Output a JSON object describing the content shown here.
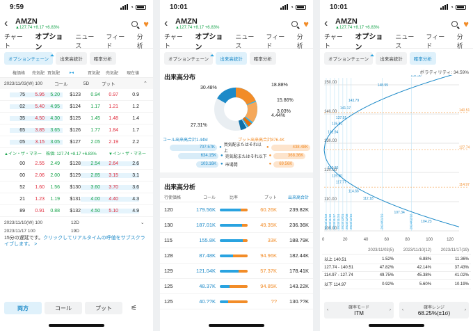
{
  "status": {
    "time1": "9:59",
    "time2": "10:01",
    "time3": "10:01"
  },
  "ticker": {
    "symbol": "AMZN",
    "change": "▲127.74 +8.17 +6.83%"
  },
  "tabs": [
    "チャート",
    "オプション",
    "ニュース",
    "フィード",
    "分析"
  ],
  "subtabs": [
    "オプションチェーン",
    "出来高統計",
    "確率分析"
  ],
  "chain": {
    "headers": [
      "権価格",
      "売気配",
      "買気配",
      "",
      "買気配",
      "売気配",
      "現在値"
    ],
    "top": {
      "date": "2023/11/03(W) 100",
      "call": "コール",
      "sd": "5D",
      "put": "プット"
    },
    "rows": [
      {
        "a": "75",
        "b": "5.95",
        "c": "5.20",
        "k": "$123",
        "d": "0.94",
        "e": "0.97",
        "f": "0.9"
      },
      {
        "a": "02",
        "b": "5.40",
        "c": "4.95",
        "k": "$124",
        "d": "1.17",
        "e": "1.21",
        "f": "1.2"
      },
      {
        "a": "35",
        "b": "4.50",
        "c": "4.30",
        "k": "$125",
        "d": "1.45",
        "e": "1.48",
        "f": "1.4"
      },
      {
        "a": "65",
        "b": "3.85",
        "c": "3.65",
        "k": "$126",
        "d": "1.77",
        "e": "1.84",
        "f": "1.7"
      },
      {
        "a": "05",
        "b": "3.15",
        "c": "3.05",
        "k": "$127",
        "d": "2.05",
        "e": "2.19",
        "f": "2.2"
      }
    ],
    "itm_left": "▲イン・ザ・マネー",
    "price_line": "株価: 127.74 +8.17 +6.83%",
    "itm_right": "▼イン・ザ・マネー",
    "rows2": [
      {
        "a": "00",
        "b": "2.55",
        "c": "2.49",
        "k": "$128",
        "d": "2.54",
        "e": "2.64",
        "f": "2.6"
      },
      {
        "a": "00",
        "b": "2.06",
        "c": "2.00",
        "k": "$129",
        "d": "2.85",
        "e": "3.15",
        "f": "3.1"
      },
      {
        "a": "52",
        "b": "1.60",
        "c": "1.56",
        "k": "$130",
        "d": "3.60",
        "e": "3.70",
        "f": "3.6"
      },
      {
        "a": "21",
        "b": "1.23",
        "c": "1.19",
        "k": "$131",
        "d": "4.00",
        "e": "4.40",
        "f": "4.3"
      },
      {
        "a": "89",
        "b": "0.91",
        "c": "0.88",
        "k": "$132",
        "d": "4.50",
        "e": "5.10",
        "f": "4.9"
      }
    ],
    "date2": "2023/11/10(W) 100",
    "d2": "12D",
    "date3": "2023/11/17 100",
    "d3": "19D",
    "notice": "15分の遅延です。",
    "notice_link": "クリックしてリアルタイムの呼値をサブスクライブします。 >",
    "buttons": [
      "両方",
      "コール",
      "プット"
    ]
  },
  "dist": {
    "title": "出来高分布",
    "labels": [
      "30.48%",
      "18.88%",
      "15.86%",
      "3.03%",
      "4.44%",
      "27.31%"
    ],
    "call_total": "コール出来高合計1.44M",
    "put_total": "プット出来高合計876.4K",
    "rows": [
      {
        "cv": "707.57K",
        "lbl": "買気配またはそれ以上",
        "pv": "438.48K"
      },
      {
        "cv": "634.15K",
        "lbl": "売気配またはそれ以下",
        "pv": "368.36K"
      },
      {
        "cv": "103.16K",
        "lbl": "市場間",
        "pv": "69.56K"
      }
    ],
    "vol_title": "出来高分析",
    "vol_headers": [
      "行使価格",
      "コール",
      "比率",
      "プット",
      "出来高合計"
    ],
    "vol_rows": [
      {
        "s": "120",
        "c": "179.56K",
        "p": "60.26K",
        "t": "239.82K",
        "r": 0.75
      },
      {
        "s": "130",
        "c": "187.01K",
        "p": "49.35K",
        "t": "236.36K",
        "r": 0.79
      },
      {
        "s": "115",
        "c": "155.8K",
        "p": "33K",
        "t": "188.79K",
        "r": 0.83
      },
      {
        "s": "128",
        "c": "87.48K",
        "p": "94.96K",
        "t": "182.44K",
        "r": 0.48
      },
      {
        "s": "129",
        "c": "121.04K",
        "p": "57.37K",
        "t": "178.41K",
        "r": 0.68
      },
      {
        "s": "125",
        "c": "48.37K",
        "p": "94.85K",
        "t": "143.22K",
        "r": 0.34
      },
      {
        "s": "125",
        "c": "40.??K",
        "p": "??",
        "t": "130.??K",
        "r": 0.31
      }
    ]
  },
  "prob": {
    "iv": "ボラティリティ: 34.59%",
    "yticks": [
      "150.00",
      "140.00",
      "130.00",
      "120.00",
      "110.00",
      "100.00"
    ],
    "xticks": [
      "0",
      "20",
      "40",
      "60",
      "80",
      "100",
      "120"
    ],
    "upper": [
      "132.94",
      "135.81",
      "137.91",
      "141.17",
      "143.79",
      "148.99",
      "152.38"
    ],
    "lower": [
      "122.60",
      "119.90",
      "117.77",
      "114.66",
      "112.18",
      "107.34",
      "104.23"
    ],
    "right": [
      "140.51",
      "127.74",
      "114.97"
    ],
    "dates": [
      "2023/11/03",
      "2023/11/10",
      "2023/11/17",
      "2023/11/24",
      "2023/12/01",
      "2023/12/08",
      "2023/12/15",
      "2024/01/19",
      "2024/02/16"
    ],
    "table_head": [
      "",
      "2023/11/03(5)",
      "2023/11/10(12)",
      "2023/11/17(19)"
    ],
    "table": [
      [
        "以上 140.51",
        "1.52%",
        "6.88%",
        "11.36%"
      ],
      [
        "127.74 - 140.51",
        "47.82%",
        "42.14%",
        "37.43%"
      ],
      [
        "114.97 - 127.74",
        "49.75%",
        "45.38%",
        "41.02%"
      ],
      [
        "以下 114.97",
        "0.92%",
        "5.60%",
        "10.19%"
      ]
    ],
    "mode_label": "確率モード",
    "mode_val": "ITM",
    "range_label": "確率レンジ",
    "range_val": "68.25%(±1σ)"
  },
  "colors": {
    "accent": "#29a3e0",
    "orange": "#f28c28",
    "call": "#1d8ac8"
  }
}
